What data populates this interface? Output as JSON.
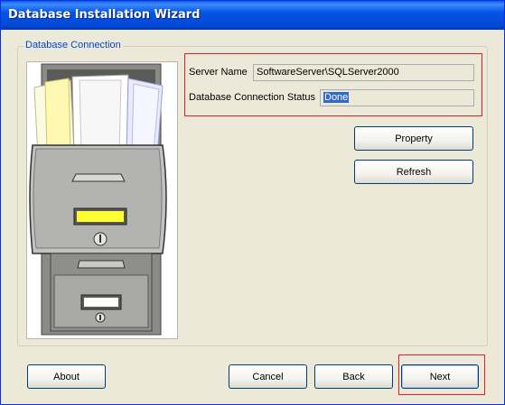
{
  "window": {
    "title": "Database Installation Wizard"
  },
  "group": {
    "legend": "Database Connection"
  },
  "fields": {
    "server_name_label": "Server Name",
    "server_name_value": "SoftwareServer\\SQLServer2000",
    "status_label": "Database Connection Status",
    "status_value": "Done"
  },
  "buttons": {
    "property": "Property",
    "refresh": "Refresh",
    "about": "About",
    "cancel": "Cancel",
    "back": "Back",
    "next": "Next"
  },
  "colors": {
    "title_bar": "#0454e8",
    "legend": "#0046d5",
    "highlight": "#e02020"
  },
  "icons": [
    "file-cabinet-illustration"
  ]
}
